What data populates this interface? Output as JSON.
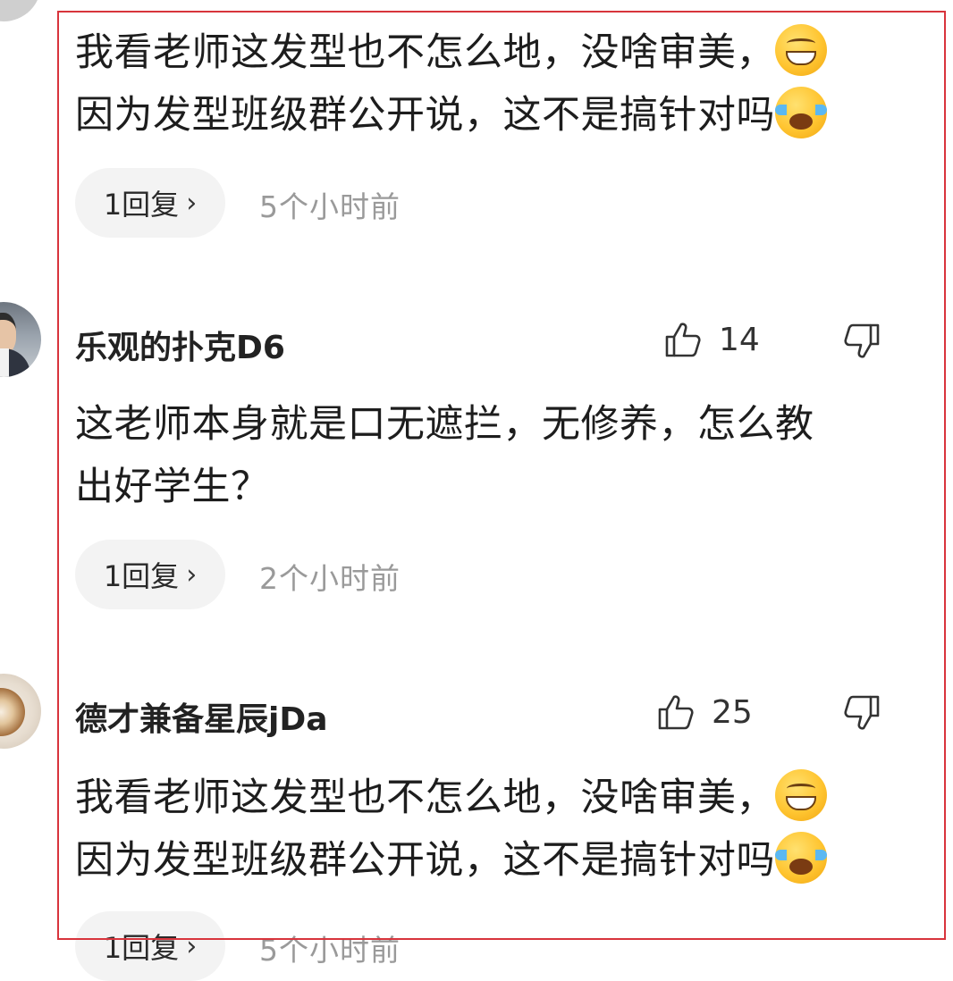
{
  "comments": [
    {
      "line1": "我看老师这发型也不怎么地，没啥审美，",
      "line2": "因为发型班级群公开说，这不是搞针对吗",
      "emoji1": "grinning-face-icon",
      "emoji2": "crying-laughing-face-icon",
      "reply_label": "1回复",
      "time": "5个小时前"
    },
    {
      "username": "乐观的扑克D6",
      "likes": "14",
      "line1": "这老师本身就是口无遮拦，无修养，怎么教",
      "line2": "出好学生？",
      "reply_label": "1回复",
      "time": "2个小时前"
    },
    {
      "username": "德才兼备星辰jDa",
      "likes": "25",
      "line1": "我看老师这发型也不怎么地，没啥审美，",
      "line2": "因为发型班级群公开说，这不是搞针对吗",
      "emoji1": "grinning-face-icon",
      "emoji2": "crying-laughing-face-icon",
      "reply_label": "1回复",
      "time": "5个小时前"
    }
  ],
  "chevron": "›",
  "colors": {
    "highlight_border": "#d8343c",
    "pill_bg": "#f3f3f3",
    "timestamp": "#9a9a9a"
  }
}
